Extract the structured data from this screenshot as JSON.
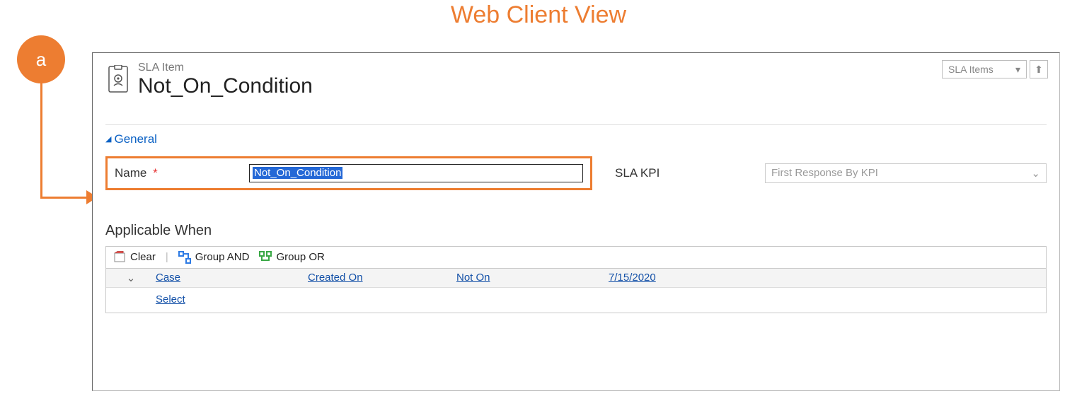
{
  "page": {
    "title": "Web Client View"
  },
  "annotation": {
    "badge": "a"
  },
  "header": {
    "entity_type": "SLA Item",
    "entity_title": "Not_On_Condition",
    "view_picker": {
      "current": "SLA Items"
    }
  },
  "section": {
    "general_label": "General"
  },
  "form": {
    "name_label": "Name",
    "name_required_marker": "*",
    "name_value": "Not_On_Condition",
    "kpi_label": "SLA KPI",
    "kpi_value": "First Response By KPI"
  },
  "applicable": {
    "title": "Applicable When",
    "toolbar": {
      "clear": "Clear",
      "group_and": "Group AND",
      "group_or": "Group OR"
    },
    "rows": [
      {
        "entity": "Case",
        "field": "Created On",
        "operator": "Not On",
        "value": "7/15/2020"
      }
    ],
    "select_label": "Select"
  }
}
